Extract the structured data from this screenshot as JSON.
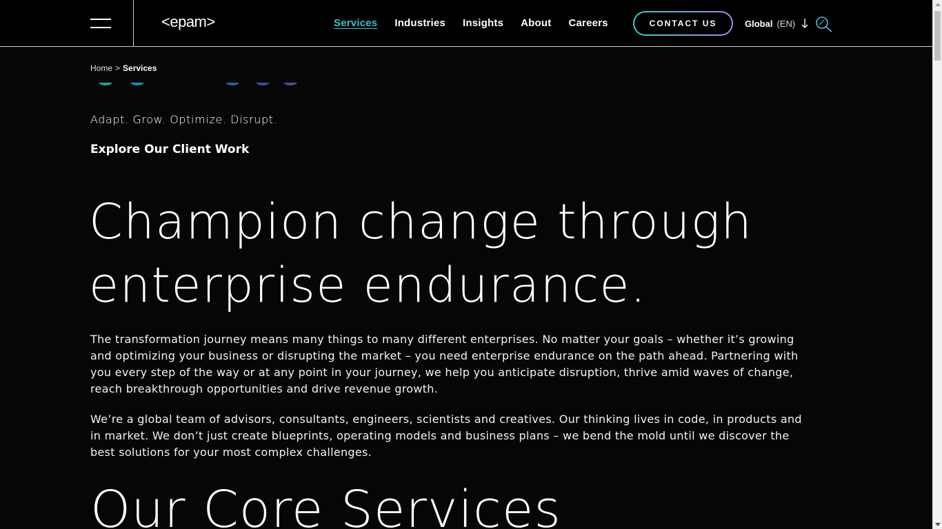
{
  "header": {
    "logo_text": "<epam>",
    "nav": [
      {
        "label": "Services",
        "active": true
      },
      {
        "label": "Industries",
        "active": false
      },
      {
        "label": "Insights",
        "active": false
      },
      {
        "label": "About",
        "active": false
      },
      {
        "label": "Careers",
        "active": false
      }
    ],
    "contact_label": "CONTACT US",
    "language": {
      "region": "Global",
      "code": "(EN)"
    },
    "accent_color": "#30c7d1"
  },
  "breadcrumb": {
    "home": "Home",
    "separator": ">",
    "current": "Services"
  },
  "intro": {
    "tagline": "Adapt. Grow. Optimize. Disrupt.",
    "explore_link": "Explore Our Client Work"
  },
  "hero": {
    "title_line1": "Champion change through",
    "title_line2": "enterprise endurance."
  },
  "body": {
    "paragraph1": "The transformation journey means many things to many different enterprises. No matter your goals – whether it’s growing and optimizing your business or disrupting the market – you need enterprise endurance on the path ahead. Partnering with you every step of the way or at any point in your journey, we help you anticipate disruption, thrive amid waves of change, reach breakthrough opportunities and drive revenue growth.",
    "paragraph2": "We’re a global team of advisors, consultants, engineers, scientists and creatives. Our thinking lives in code, in products and in market. We don’t just create blueprints, operating models and business plans – we bend the mold until we discover the best solutions for your most complex challenges."
  },
  "sections": {
    "core_services_title": "Our Core Services"
  }
}
